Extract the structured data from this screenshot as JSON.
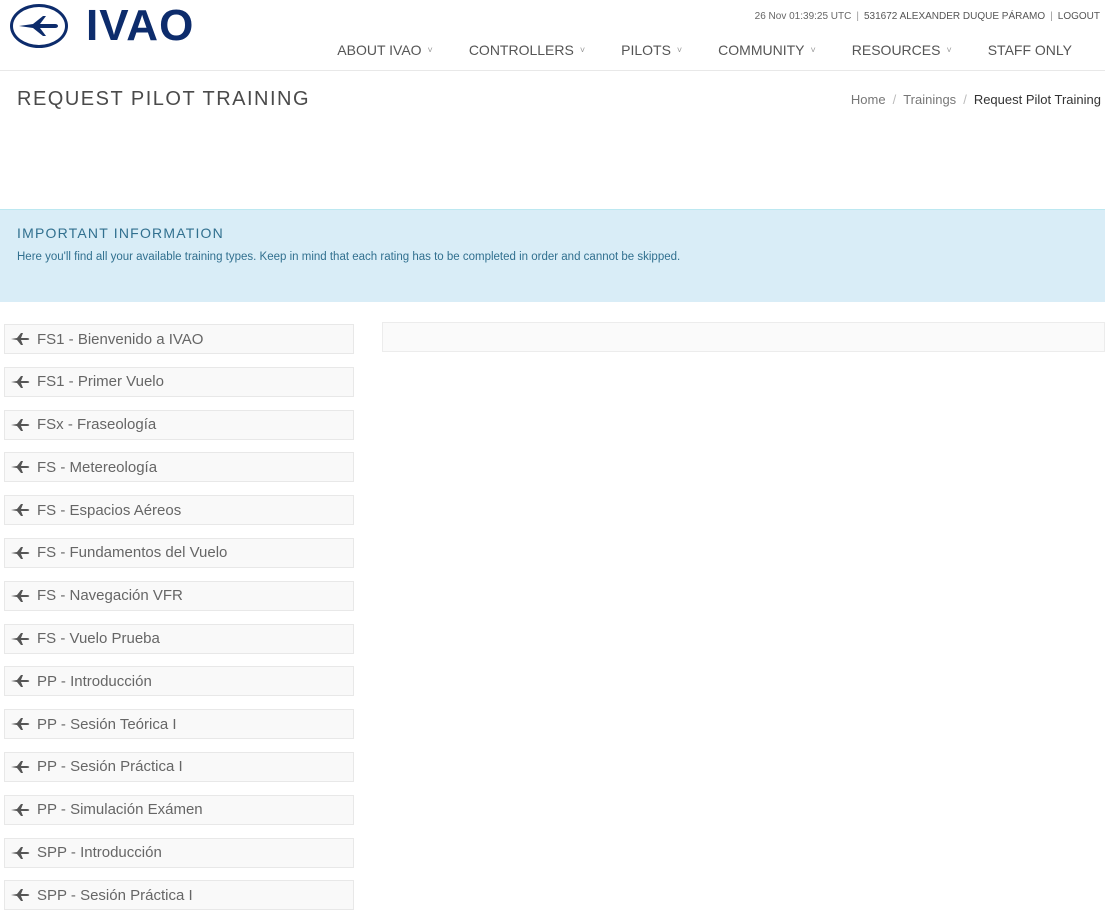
{
  "colors": {
    "brand": "#0d2c6c",
    "info_bg": "#d9edf7",
    "info_text": "#31708f"
  },
  "header": {
    "logo_text": "IVAO",
    "logo_icon": "airplane-logo-icon",
    "top_bar": {
      "datetime": "26 Nov 01:39:25 UTC",
      "user": "531672 ALEXANDER DUQUE PÁRAMO",
      "logout": "LOGOUT"
    },
    "nav": {
      "about": "ABOUT IVAO",
      "controllers": "CONTROLLERS",
      "pilots": "PILOTS",
      "community": "COMMUNITY",
      "resources": "RESOURCES",
      "staff": "STAFF ONLY"
    },
    "chevron": "˅"
  },
  "page": {
    "title": "REQUEST PILOT TRAINING",
    "breadcrumb": {
      "home": "Home",
      "trainings": "Trainings",
      "current": "Request Pilot Training",
      "sep": "/"
    }
  },
  "info": {
    "title": "IMPORTANT INFORMATION",
    "text": "Here you'll find all your available training types. Keep in mind that each rating has to be completed in order and cannot be skipped."
  },
  "trainings": [
    "FS1 - Bienvenido a IVAO",
    "FS1 - Primer Vuelo",
    "FSx - Fraseología",
    "FS - Metereología",
    "FS - Espacios Aéreos",
    "FS - Fundamentos del Vuelo",
    "FS - Navegación VFR",
    "FS - Vuelo Prueba",
    "PP - Introducción",
    "PP - Sesión Teórica I",
    "PP - Sesión Práctica I",
    "PP - Simulación Exámen",
    "SPP - Introducción",
    "SPP - Sesión Práctica I"
  ]
}
